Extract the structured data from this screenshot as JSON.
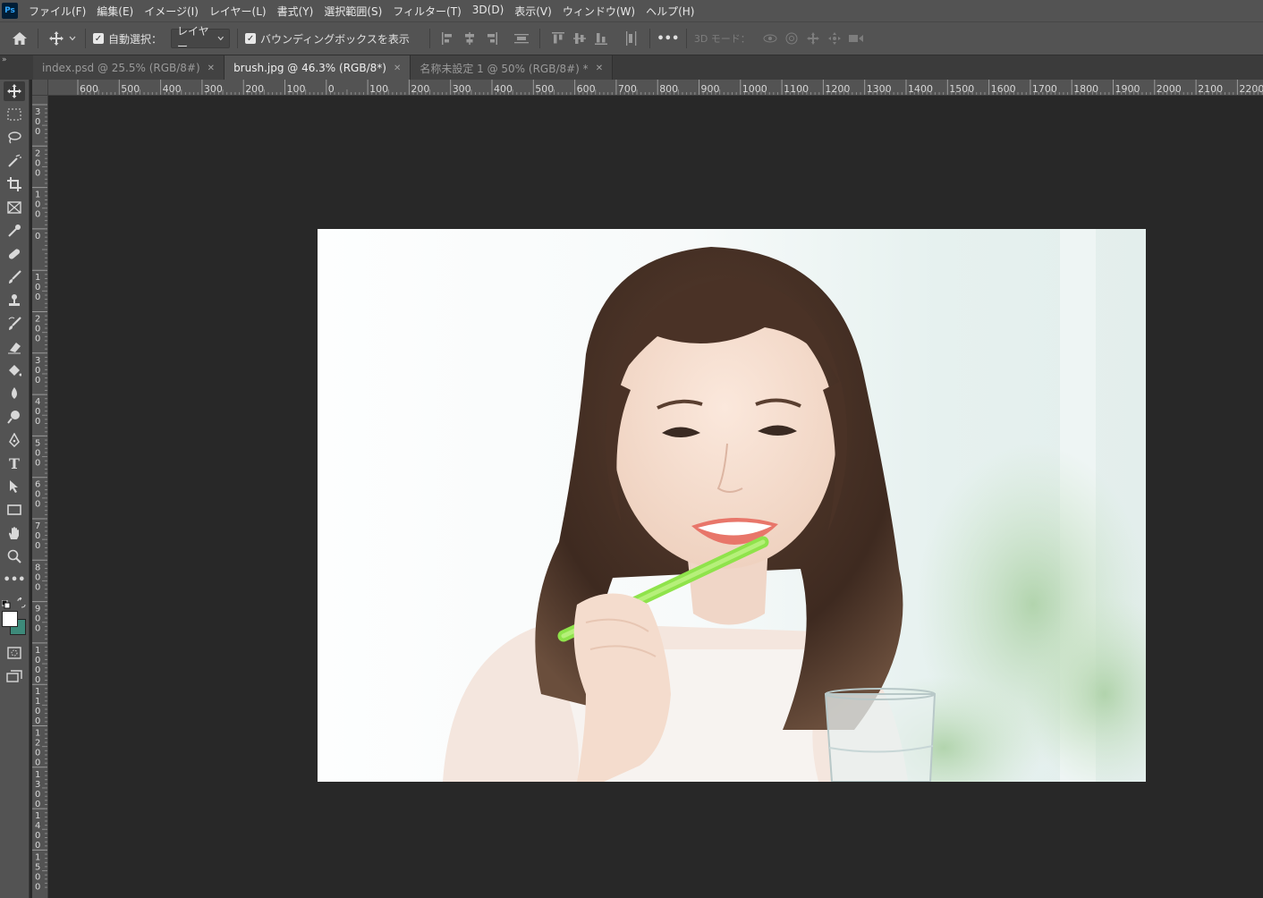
{
  "app": {
    "logo_text": "Ps"
  },
  "menu": {
    "items": [
      "ファイル(F)",
      "編集(E)",
      "イメージ(I)",
      "レイヤー(L)",
      "書式(Y)",
      "選択範囲(S)",
      "フィルター(T)",
      "3D(D)",
      "表示(V)",
      "ウィンドウ(W)",
      "ヘルプ(H)"
    ]
  },
  "options": {
    "auto_select_label": "自動選択：",
    "auto_select_checked": true,
    "auto_select_target": "レイヤー",
    "bounding_box_label": "バウンディングボックスを表示",
    "bounding_box_checked": true,
    "mode_3d_label": "3D モード：",
    "more_label": "•••"
  },
  "tabs": [
    {
      "label": "index.psd @ 25.5% (RGB/8#)",
      "active": false
    },
    {
      "label": "brush.jpg @ 46.3% (RGB/8*)",
      "active": true
    },
    {
      "label": "名称未設定 1 @ 50% (RGB/8#) *",
      "active": false
    }
  ],
  "rulers": {
    "horizontal_labels": [
      "600",
      "500",
      "400",
      "300",
      "200",
      "100",
      "0",
      "100",
      "200",
      "300",
      "400",
      "500",
      "600",
      "700",
      "800",
      "900",
      "1000",
      "1100",
      "1200",
      "1300",
      "1400",
      "1500",
      "1600",
      "1700",
      "1800",
      "1900",
      "2000",
      "2100",
      "2200"
    ],
    "vertical_labels": [
      "300",
      "200",
      "100",
      "0",
      "100",
      "200",
      "300",
      "400",
      "500",
      "600",
      "700",
      "800",
      "900",
      "1000",
      "1100",
      "1200",
      "1300",
      "1400",
      "1500"
    ]
  },
  "colors": {
    "foreground": "#ffffff",
    "background": "#3d8a7a"
  }
}
